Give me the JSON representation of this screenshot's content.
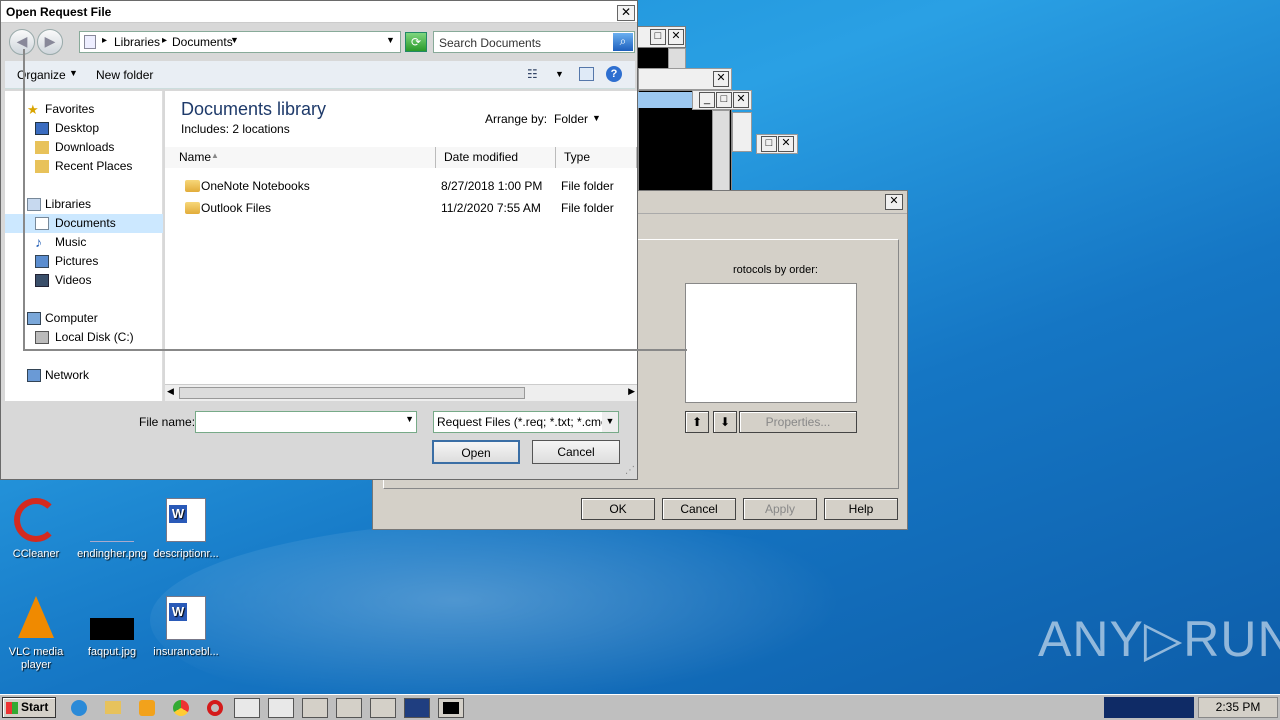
{
  "dialog": {
    "title": "Open Request File",
    "close": "✕",
    "address": {
      "segments": [
        "Libraries",
        "Documents"
      ],
      "separator": "▸"
    },
    "search_placeholder": "Search Documents",
    "toolbar": {
      "organize": "Organize",
      "new_folder": "New folder"
    },
    "nav": {
      "favorites": "Favorites",
      "desktop": "Desktop",
      "downloads": "Downloads",
      "recent": "Recent Places",
      "libraries": "Libraries",
      "documents": "Documents",
      "music": "Music",
      "pictures": "Pictures",
      "videos": "Videos",
      "computer": "Computer",
      "local_disk": "Local Disk (C:)",
      "network": "Network"
    },
    "library": {
      "title": "Documents library",
      "includes": "Includes:  2 locations",
      "arrange_label": "Arrange by:",
      "arrange_value": "Folder"
    },
    "columns": [
      "Name",
      "Date modified",
      "Type"
    ],
    "files": [
      {
        "name": "OneNote Notebooks",
        "date": "8/27/2018 1:00 PM",
        "type": "File folder"
      },
      {
        "name": "Outlook Files",
        "date": "11/2/2020 7:55 AM",
        "type": "File folder"
      }
    ],
    "filename_label": "File name:",
    "filename_value": "",
    "filetype_value": "Request Files (*.req; *.txt; *.cmc;",
    "open": "Open",
    "cancel": "Cancel"
  },
  "bg_dialog": {
    "protocols_label": "rotocols by order:",
    "properties": "Properties...",
    "ok": "OK",
    "cancel": "Cancel",
    "apply": "Apply",
    "help": "Help"
  },
  "desktop": {
    "icons": [
      {
        "label": "CCleaner"
      },
      {
        "label": "endingher.png"
      },
      {
        "label": "descriptionr..."
      },
      {
        "label": "VLC media player"
      },
      {
        "label": "faqput.jpg"
      },
      {
        "label": "insurancebl..."
      }
    ],
    "watermark": "ANY▷RUN"
  },
  "taskbar": {
    "start": "Start",
    "clock": "2:35 PM"
  },
  "colors": {
    "accent": "#1e8fd6",
    "selection": "#cce8ff"
  }
}
